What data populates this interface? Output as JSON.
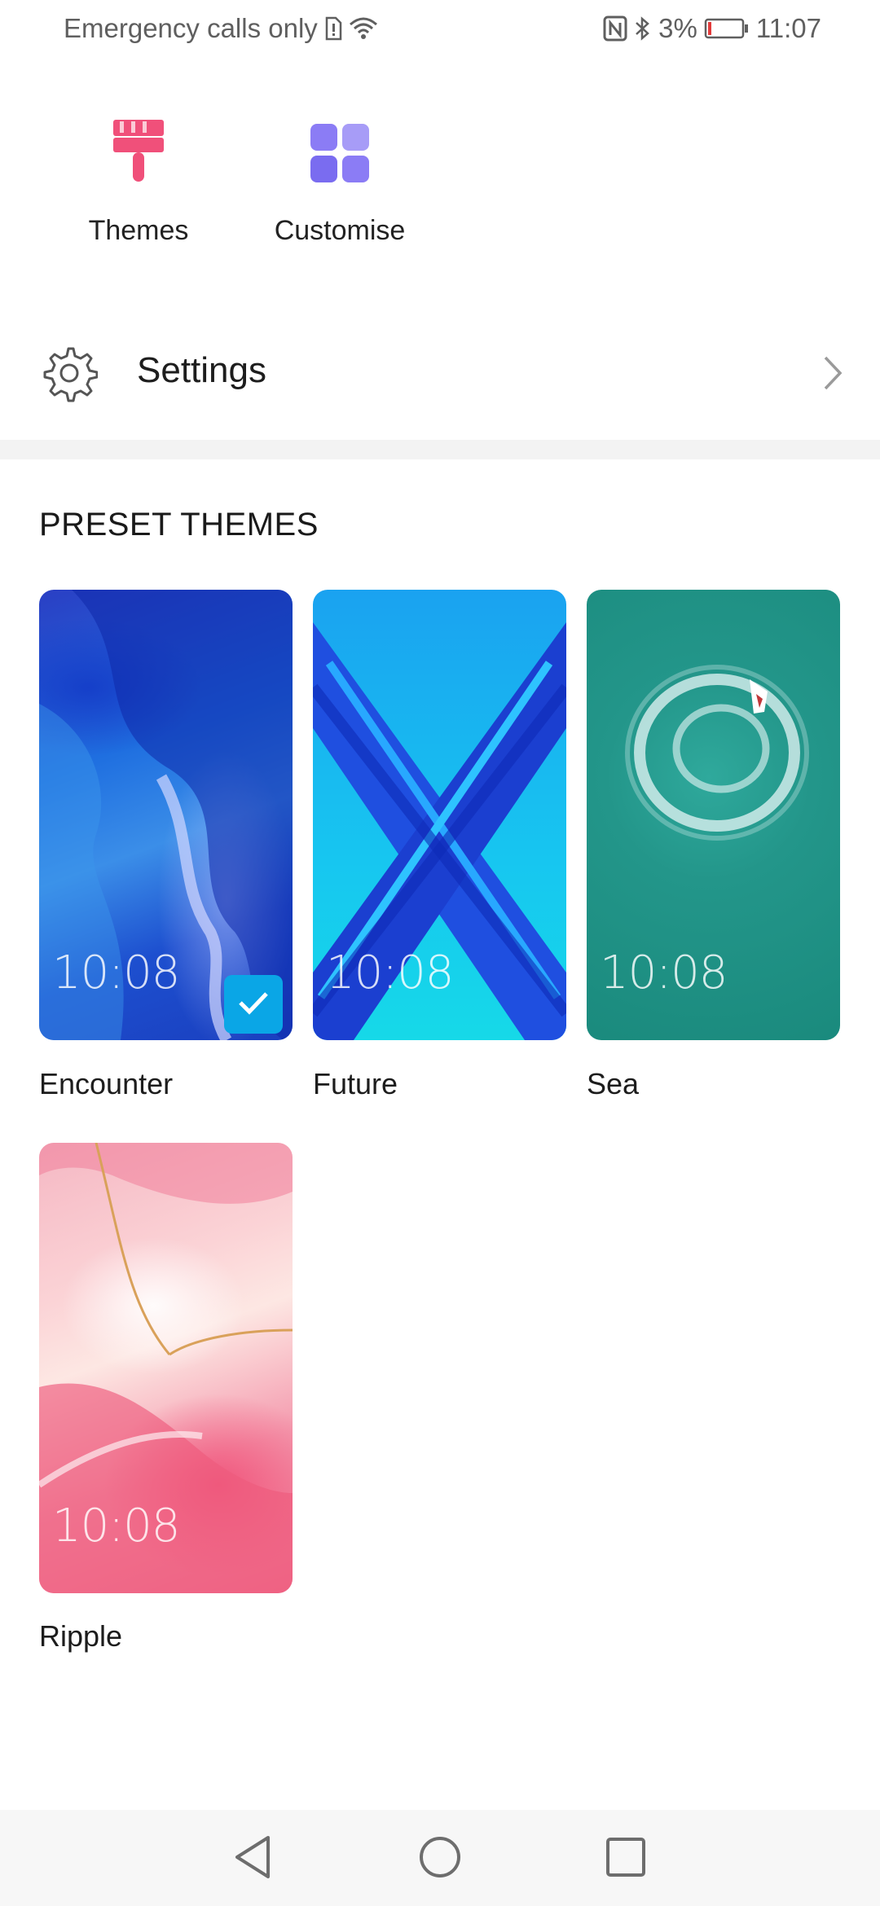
{
  "status_bar": {
    "carrier_text": "Emergency calls only",
    "battery_percent": "3%",
    "time": "11:07"
  },
  "shortcuts": {
    "themes_label": "Themes",
    "customise_label": "Customise"
  },
  "settings": {
    "label": "Settings"
  },
  "section": {
    "title": "PRESET THEMES"
  },
  "themes": [
    {
      "name": "Encounter",
      "time": "10:08",
      "selected": true
    },
    {
      "name": "Future",
      "time": "10:08",
      "selected": false
    },
    {
      "name": "Sea",
      "time": "10:08",
      "selected": false
    },
    {
      "name": "Ripple",
      "time": "10:08",
      "selected": false
    }
  ],
  "colors": {
    "themes_icon": "#f0507a",
    "customise_icon": "#7a6cf0",
    "check_badge": "#0aa6e6"
  }
}
